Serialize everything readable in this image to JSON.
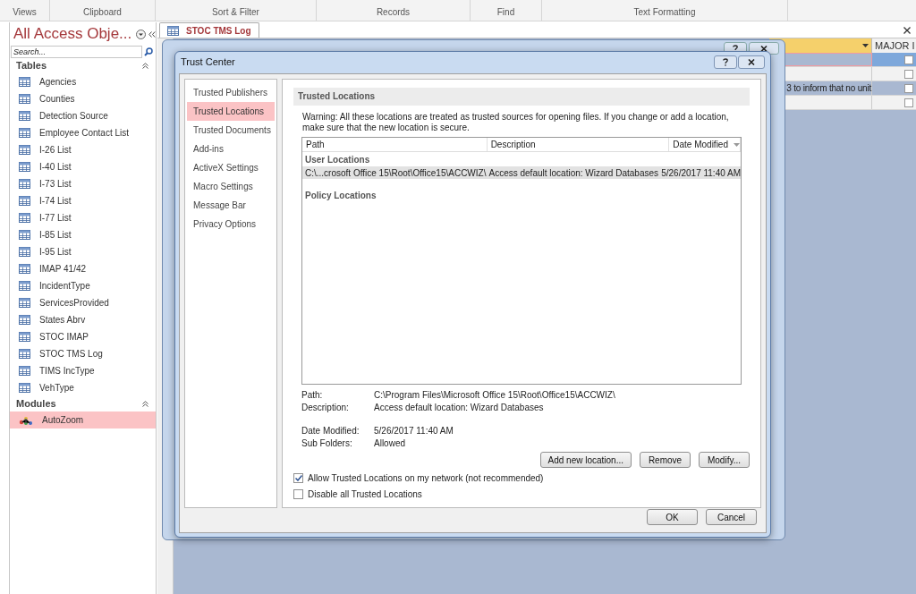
{
  "ribbon": {
    "groups": [
      "Views",
      "Clipboard",
      "Sort & Filter",
      "Records",
      "Find",
      "Text Formatting"
    ]
  },
  "navigation": {
    "title": "All Access Obje...",
    "search": {
      "placeholder": "Search..."
    },
    "sections": [
      {
        "title": "Tables",
        "kind": "table",
        "items": [
          {
            "label": "Agencies",
            "selected": false
          },
          {
            "label": "Counties",
            "selected": false
          },
          {
            "label": "Detection Source",
            "selected": false
          },
          {
            "label": "Employee Contact List",
            "selected": false
          },
          {
            "label": "I-26 List",
            "selected": false
          },
          {
            "label": "I-40 List",
            "selected": false
          },
          {
            "label": "I-73 List",
            "selected": false
          },
          {
            "label": "I-74 List",
            "selected": false
          },
          {
            "label": "I-77 List",
            "selected": false
          },
          {
            "label": "I-85 List",
            "selected": false
          },
          {
            "label": "I-95 List",
            "selected": false
          },
          {
            "label": "IMAP 41/42",
            "selected": false
          },
          {
            "label": "IncidentType",
            "selected": false
          },
          {
            "label": "ServicesProvided",
            "selected": false
          },
          {
            "label": "States Abrv",
            "selected": false
          },
          {
            "label": "STOC IMAP",
            "selected": false
          },
          {
            "label": "STOC TMS Log",
            "selected": false
          },
          {
            "label": "TIMS IncType",
            "selected": false
          },
          {
            "label": "VehType",
            "selected": false
          }
        ]
      },
      {
        "title": "Modules",
        "kind": "module",
        "items": [
          {
            "label": "AutoZoom",
            "selected": true
          }
        ]
      }
    ]
  },
  "document_tab": {
    "label": "STOC TMS Log"
  },
  "datasheet": {
    "columns": [
      "MAJOR I"
    ],
    "rows": [
      {
        "selected": true,
        "checked": false
      },
      {
        "selected": false,
        "checked": false
      },
      {
        "text": "3 to inform that no unit",
        "selected": false,
        "checked": false
      },
      {
        "selected": false,
        "checked": false
      }
    ]
  },
  "trust_center": {
    "title": "Trust Center",
    "categories": [
      {
        "label": "Trusted Publishers",
        "selected": false
      },
      {
        "label": "Trusted Locations",
        "selected": true
      },
      {
        "label": "Trusted Documents",
        "selected": false
      },
      {
        "label": "Add-ins",
        "selected": false
      },
      {
        "label": "ActiveX Settings",
        "selected": false
      },
      {
        "label": "Macro Settings",
        "selected": false
      },
      {
        "label": "Message Bar",
        "selected": false
      },
      {
        "label": "Privacy Options",
        "selected": false
      }
    ],
    "section_title": "Trusted Locations",
    "warning": "Warning: All these locations are treated as trusted sources for opening files.  If you change or add a location, make sure that the new location is secure.",
    "table": {
      "columns": [
        "Path",
        "Description",
        "Date Modified"
      ],
      "groups": [
        {
          "title": "User Locations",
          "rows": [
            {
              "path": "C:\\...crosoft Office 15\\Root\\Office15\\ACCWIZ\\",
              "description": "Access default location: Wizard Databases",
              "date": "5/26/2017 11:40 AM",
              "selected": true
            }
          ]
        },
        {
          "title": "Policy Locations"
        }
      ]
    },
    "details": [
      {
        "label": "Path:",
        "value": "C:\\Program Files\\Microsoft Office 15\\Root\\Office15\\ACCWIZ\\"
      },
      {
        "label": "Description:",
        "value": "Access default location: Wizard Databases"
      },
      {
        "label": "Date Modified:",
        "value": "5/26/2017 11:40 AM"
      },
      {
        "label": "Sub Folders:",
        "value": "Allowed"
      }
    ],
    "buttons": [
      "Add new location...",
      "Remove",
      "Modify..."
    ],
    "checkboxes": [
      {
        "label": "Allow Trusted Locations on my network (not recommended)",
        "checked": true
      },
      {
        "label": "Disable all Trusted Locations",
        "checked": false
      }
    ],
    "footer_buttons": [
      "OK",
      "Cancel"
    ]
  }
}
